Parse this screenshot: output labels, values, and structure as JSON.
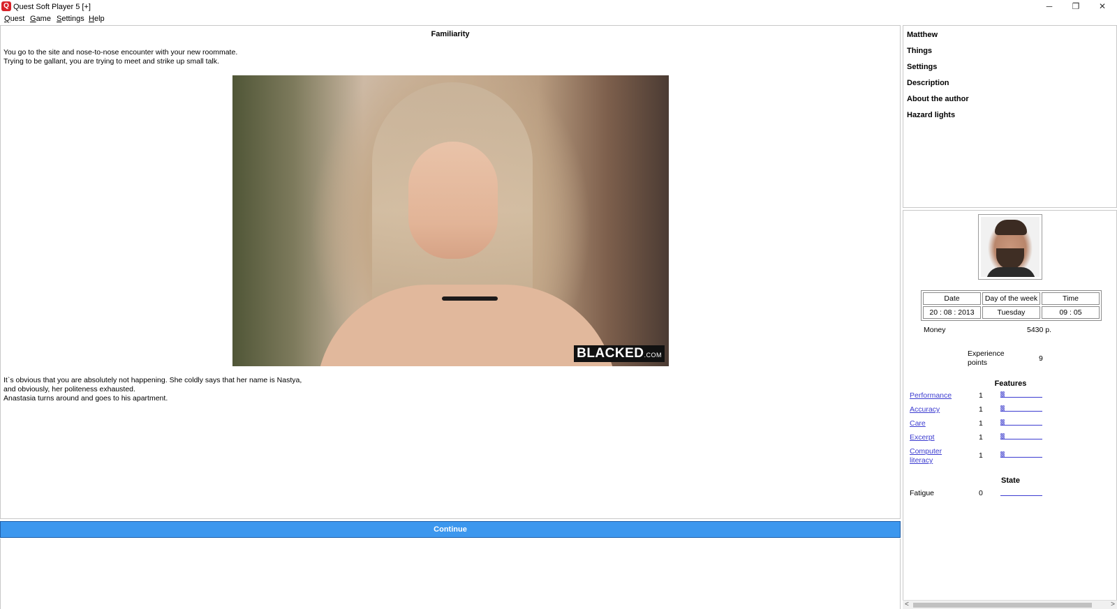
{
  "window": {
    "title": "Quest Soft Player 5 [+]",
    "app_icon_glyph": "Q",
    "controls": {
      "minimize": "─",
      "maximize": "❐",
      "close": "✕"
    }
  },
  "menu": {
    "items": [
      {
        "label": "Quest",
        "accel": "Q",
        "rest": "uest"
      },
      {
        "label": "Game",
        "accel": "G",
        "rest": "ame"
      },
      {
        "label": "Settings",
        "accel": "S",
        "rest": "ettings"
      },
      {
        "label": "Help",
        "accel": "H",
        "rest": "elp"
      }
    ]
  },
  "scene": {
    "title": "Familiarity",
    "intro": "You go to the site and nose-to-nose encounter with your new roommate.\nTrying to be gallant, you are trying to meet and strike up small talk.",
    "image_watermark": "BLACKED",
    "image_watermark_suffix": ".COM",
    "outro": "It`s obvious that you are absolutely not happening. She coldly says that her name is Nastya,\nand obviously, her politeness exhausted.\nAnastasia turns around and goes to his apartment.",
    "continue_label": "Continue"
  },
  "side_menu": {
    "items": [
      "Matthew",
      "Things",
      "Settings",
      "Description",
      "About the author",
      "Hazard lights"
    ]
  },
  "status": {
    "datetime": {
      "headers": [
        "Date",
        "Day of the week",
        "Time"
      ],
      "values": [
        "20 : 08 : 2013",
        "Tuesday",
        "09 : 05"
      ]
    },
    "money_label": "Money",
    "money_value": "5430 р.",
    "experience_label": "Experience\npoints",
    "experience_value": "9",
    "features_title": "Features",
    "features": [
      {
        "name": "Performance",
        "value": "1",
        "level": 0.1
      },
      {
        "name": "Accuracy",
        "value": "1",
        "level": 0.1
      },
      {
        "name": "Care",
        "value": "1",
        "level": 0.1
      },
      {
        "name": "Excerpt",
        "value": "1",
        "level": 0.1
      },
      {
        "name": "Computer\nliteracy",
        "value": "1",
        "level": 0.1
      }
    ],
    "state_title": "State",
    "state": [
      {
        "name": "Fatigue",
        "value": "0",
        "level": 0
      }
    ]
  },
  "scrollbar": {
    "left_arrow": "<",
    "right_arrow": ">"
  }
}
